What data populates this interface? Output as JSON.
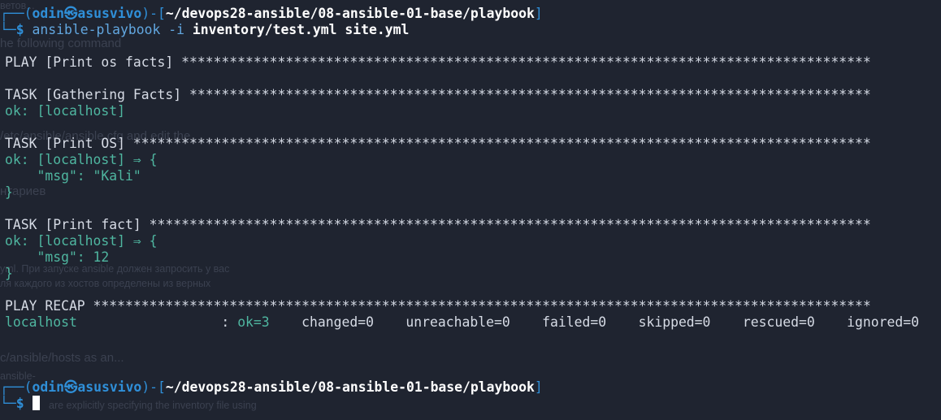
{
  "background_text": [
    "ветов...",
    "he following command",
    "/etc/ansible/ansible.cfg and edit the",
    "нтариев",
    "yml. При запуске ansible должен запросить у вас",
    "ля каждого из хостов определены из верных",
    "c/ansible/hosts as an...",
    "ansible-",
    "are explicitly specifying the inventory file using"
  ],
  "terminal": {
    "prompt1": {
      "user": "odin",
      "symbol": "㉿",
      "host": "asusvivo",
      "path": "~/devops28-ansible/08-ansible-01-base/playbook",
      "dollar": "$",
      "command": "ansible-playbook",
      "flag": "-i",
      "args": "inventory/test.yml site.yml"
    },
    "play_header": "PLAY [Print os facts] **************************************************************************************",
    "task1_header": "TASK [Gathering Facts] *************************************************************************************",
    "task1_ok": "ok: [localhost]",
    "task2_header": "TASK [Print OS] ********************************************************************************************",
    "task2_ok": "ok: [localhost] ⇒ {",
    "task2_msg": "    \"msg\": \"Kali\"",
    "task2_close": "}",
    "task3_header": "TASK [Print fact] ******************************************************************************************",
    "task3_ok": "ok: [localhost] ⇒ {",
    "task3_msg": "    \"msg\": 12",
    "task3_close": "}",
    "recap_header": "PLAY RECAP *************************************************************************************************",
    "recap": {
      "host": "localhost",
      "colon": "                  : ",
      "ok": "ok=3",
      "rest": "    changed=0    unreachable=0    failed=0    skipped=0    rescued=0    ignored=0"
    },
    "prompt2": {
      "user": "odin",
      "symbol": "㉿",
      "host": "asusvivo",
      "path": "~/devops28-ansible/08-ansible-01-base/playbook",
      "dollar": "$"
    }
  }
}
